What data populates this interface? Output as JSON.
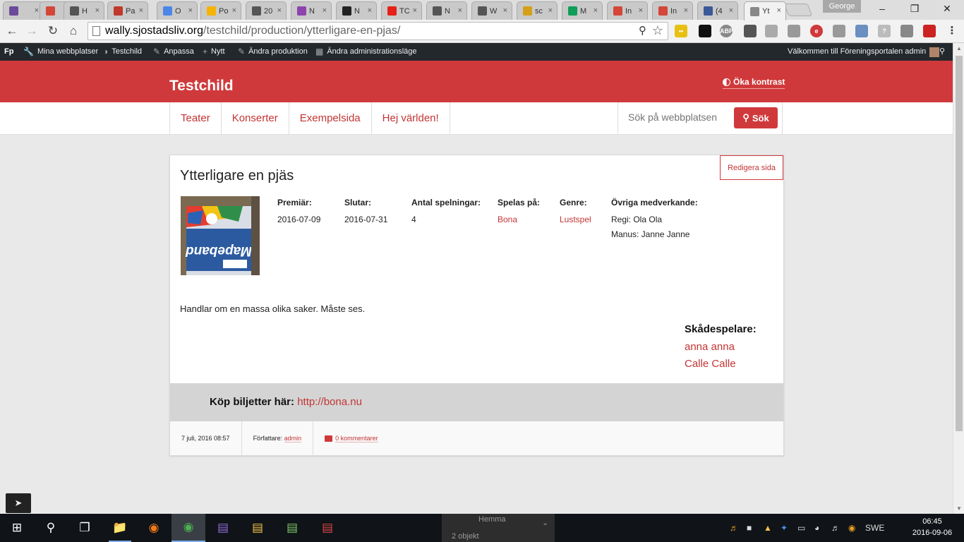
{
  "browser": {
    "tabs": [
      {
        "label": "",
        "icon": "mail-icon",
        "color": "#6c4a9b"
      },
      {
        "label": "",
        "icon": "gmail-icon",
        "color": "#d44638"
      },
      {
        "label": "H",
        "icon": "wordpress-icon",
        "color": "#555555"
      },
      {
        "label": "Pa",
        "icon": "cube-icon",
        "color": "#c0392b"
      },
      {
        "label": "O",
        "icon": "circle-icon",
        "color": "#4a86e8"
      },
      {
        "label": "Po",
        "icon": "drive-icon",
        "color": "#f4b400"
      },
      {
        "label": "20",
        "icon": "image-icon",
        "color": "#555555"
      },
      {
        "label": "N",
        "icon": "grid-icon",
        "color": "#8e44ad"
      },
      {
        "label": "N",
        "icon": "github-icon",
        "color": "#222222"
      },
      {
        "label": "TC",
        "icon": "youtube-icon",
        "color": "#e62117"
      },
      {
        "label": "N",
        "icon": "wordpress-icon",
        "color": "#555555"
      },
      {
        "label": "W",
        "icon": "wordpress-icon",
        "color": "#555555"
      },
      {
        "label": "sc",
        "icon": "tm-icon",
        "color": "#d4a017"
      },
      {
        "label": "M",
        "icon": "drive-icon",
        "color": "#0f9d58"
      },
      {
        "label": "In",
        "icon": "gmail-icon",
        "color": "#d44638"
      },
      {
        "label": "In",
        "icon": "gmail-icon",
        "color": "#d44638"
      },
      {
        "label": "(4",
        "icon": "facebook-icon",
        "color": "#3b5998"
      },
      {
        "label": "Yt",
        "icon": "page-icon",
        "color": "#888888",
        "active": true
      }
    ],
    "profile": "George",
    "url_host": "wally.sjostadsliv.org",
    "url_path": "/testchild/production/ytterligare-en-pjas/"
  },
  "adminbar": {
    "items": [
      "Mina webbplatser",
      "Testchild",
      "Anpassa",
      "Nytt",
      "Ändra produktion",
      "Ändra administrationsläge"
    ],
    "welcome": "Välkommen till Föreningsportalen admin"
  },
  "site": {
    "title": "Testchild",
    "contrast": "Öka kontrast",
    "menu": [
      "Teater",
      "Konserter",
      "Exempelsida",
      "Hej världen!"
    ],
    "search_placeholder": "Sök på webbplatsen",
    "search_button": "Sök"
  },
  "production": {
    "edit": "Redigera sida",
    "title": "Ytterligare en pjäs",
    "premiere_label": "Premiär:",
    "premiere": "2016-07-09",
    "end_label": "Slutar:",
    "end": "2016-07-31",
    "count_label": "Antal spelningar:",
    "count": "4",
    "venue_label": "Spelas på:",
    "venue": "Bona",
    "genre_label": "Genre:",
    "genre": "Lustspel",
    "others_label": "Övriga medverkande:",
    "others_1": "Regi: Ola Ola",
    "others_2": "Manus: Janne Janne",
    "description": "Handlar om en massa olika saker. Måste ses.",
    "actors_label": "Skådespelare:",
    "actors": [
      "anna anna",
      "Calle Calle"
    ],
    "tickets_label": "Köp biljetter här:",
    "tickets_url": "http://bona.nu",
    "date": "7 juli, 2016 08:57",
    "author_label": "Författare:",
    "author": "admin",
    "comments": "0 kommentarer"
  },
  "taskbar": {
    "hemma": "Hemma",
    "hemma_sub": "2 objekt",
    "lang": "SWE",
    "time": "06:45",
    "date": "2016-09-06"
  }
}
